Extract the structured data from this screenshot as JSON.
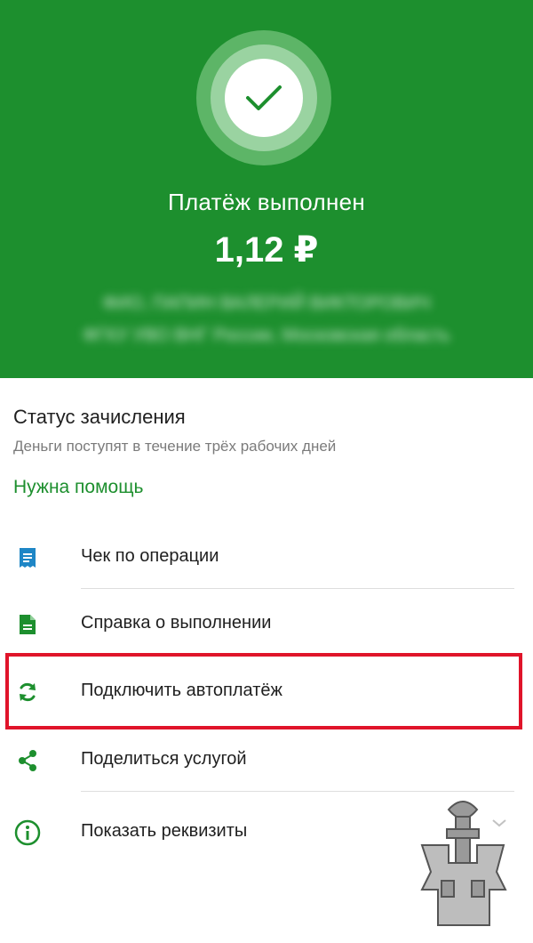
{
  "hero": {
    "title": "Платёж выполнен",
    "amount": "1,12 ₽",
    "redacted_line1": "ФИО, ПАПИН ВАЛЕРИЙ ВИКТОРОВИЧ",
    "redacted_line2": "ФГКУ УВО ВНГ России, Московская область",
    "colors": {
      "background": "#1d8f2e",
      "text": "#ffffff"
    },
    "icon": "check-icon"
  },
  "status": {
    "title": "Статус зачисления",
    "subtitle": "Деньги поступят в течение трёх рабочих дней",
    "help_link": "Нужна помощь"
  },
  "actions": [
    {
      "label": "Чек по операции",
      "icon": "receipt-icon"
    },
    {
      "label": "Справка о выполнении",
      "icon": "document-icon"
    },
    {
      "label": "Подключить автоплатёж",
      "icon": "autopay-sync-icon",
      "highlighted": true
    },
    {
      "label": "Поделиться услугой",
      "icon": "share-icon"
    },
    {
      "label": "Показать реквизиты",
      "icon": "info-icon"
    }
  ],
  "colors": {
    "accent": "#1d8f2e",
    "receipt_icon": "#1e86c6",
    "highlight_border": "#e0142a"
  }
}
